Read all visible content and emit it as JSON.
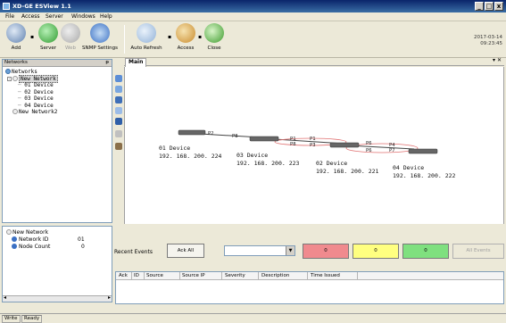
{
  "window": {
    "title": "XD-GE ESView 1.1",
    "minimize": "_",
    "maximize": "□",
    "close": "x"
  },
  "menu": [
    "File",
    "Access",
    "Server",
    "Windows",
    "Help"
  ],
  "toolbar": {
    "add": "Add",
    "server": "Server",
    "web": "Web",
    "snmp": "SNMP Settings",
    "auto_refresh": "Auto Refresh",
    "access": "Access",
    "close": "Close"
  },
  "datetime": {
    "date": "2017-03-14",
    "time": "09:23:45"
  },
  "networks_panel": {
    "title": "Networks",
    "pin": "ᵽ",
    "tree": {
      "root": "Networks",
      "network1": "New Network",
      "devices": [
        "01 Device",
        "02 Device",
        "03 Device",
        "04 Device"
      ],
      "network2": "New Network2"
    }
  },
  "properties": {
    "network": "New Network",
    "network_id_label": "Network ID",
    "network_id": "01",
    "node_count_label": "Node Count",
    "node_count": "0"
  },
  "tab": {
    "main": "Main",
    "menu_glyph": "▾ ✕"
  },
  "topology": {
    "devices": [
      {
        "name": "01 Device",
        "ip": "192. 168. 200. 224"
      },
      {
        "name": "03 Device",
        "ip": "192. 168. 200. 223"
      },
      {
        "name": "02 Device",
        "ip": "192. 168. 200. 221"
      },
      {
        "name": "04 Device",
        "ip": "192. 168. 200. 222"
      }
    ],
    "ports": [
      "P2",
      "P8",
      "P1",
      "P1",
      "P8",
      "P3",
      "P6",
      "P4",
      "P6",
      "P7"
    ]
  },
  "events": {
    "label": "Recent Events",
    "ack_all": "Ack All",
    "filter_value": "",
    "severity_counts": {
      "red": "0",
      "yellow": "0",
      "green": "0"
    },
    "all_events": "All Events",
    "columns": [
      "Ack",
      "ID",
      "Source",
      "Source IP",
      "Severity",
      "Description",
      "Time Issued"
    ],
    "colors": {
      "red": "#f08a8e",
      "yellow": "#ffff80",
      "green": "#7fe07f"
    }
  },
  "status": {
    "mode": "Write",
    "state": "Ready"
  }
}
